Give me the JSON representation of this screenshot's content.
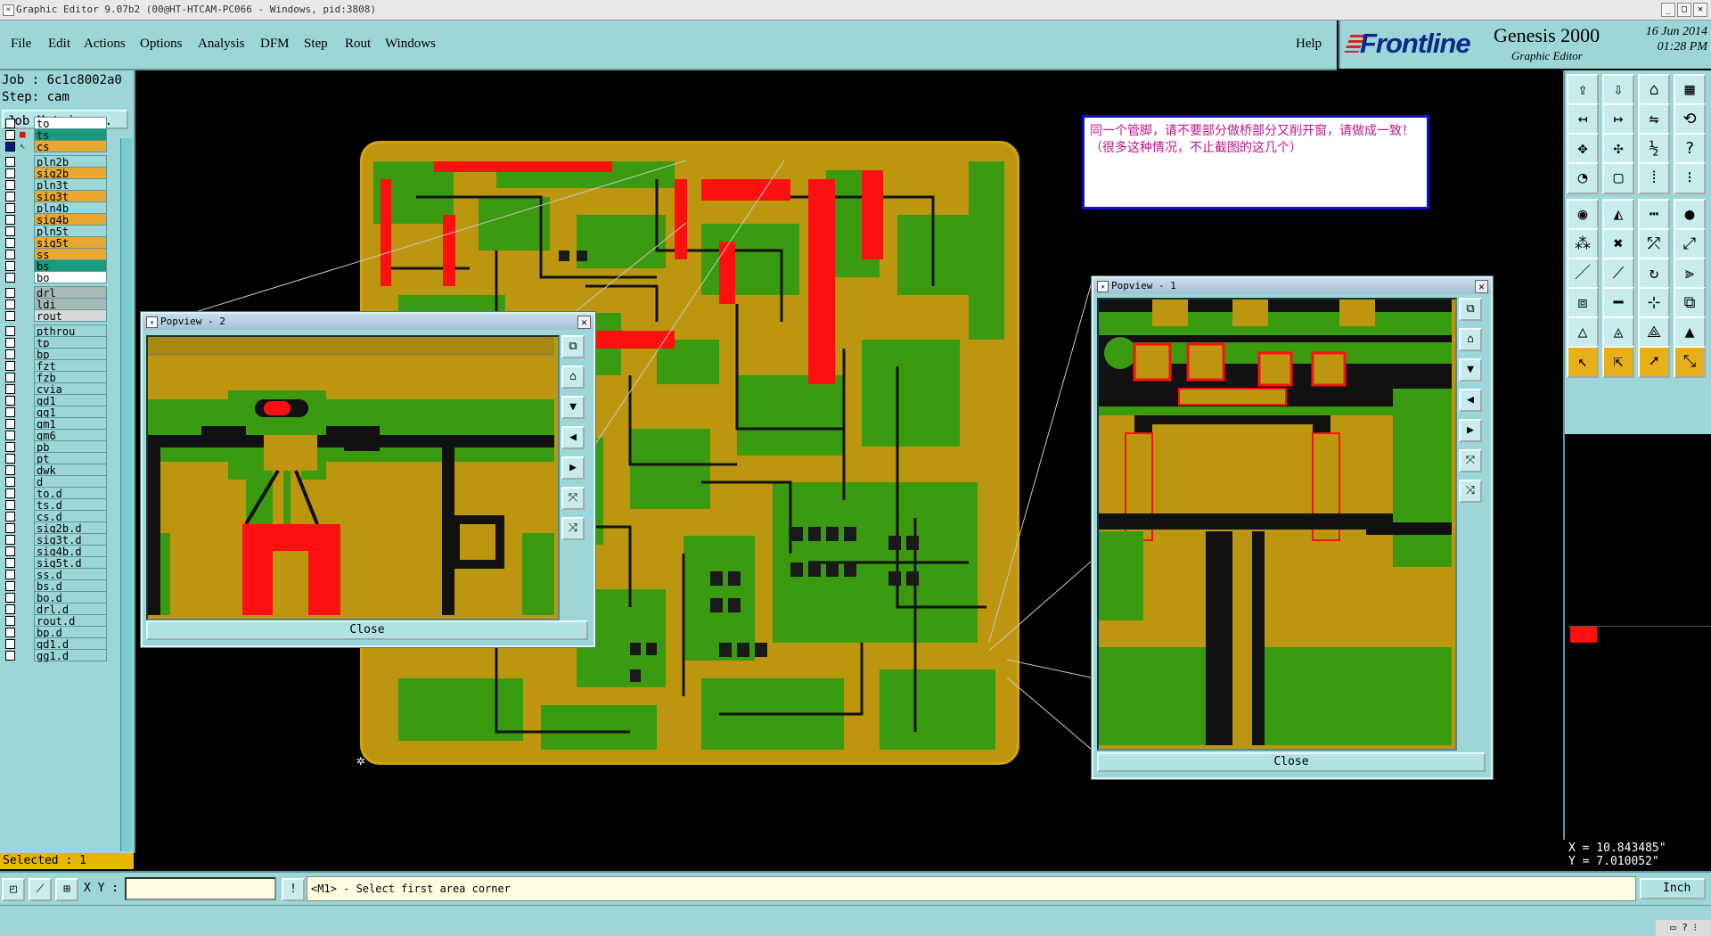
{
  "window": {
    "title": "Graphic Editor 9.07b2 (00@HT-HTCAM-PC066 - Windows, pid:3808)"
  },
  "menu": {
    "items": [
      "File",
      "Edit",
      "Actions",
      "Options",
      "Analysis",
      "DFM",
      "Step",
      "Rout",
      "Windows"
    ],
    "help": "Help"
  },
  "logo": {
    "brand": "Frontline",
    "product": "Genesis 2000",
    "subtitle": "Graphic Editor",
    "date": "16 Jun 2014",
    "time": "01:28 PM"
  },
  "job": {
    "job": "Job  : 6c1c8002a0",
    "step": "Step: cam",
    "matrix_button": "Job Matrix ..."
  },
  "layers": [
    {
      "name": "to",
      "color": "#ffffff"
    },
    {
      "name": "ts",
      "color": "#1a9a7a"
    },
    {
      "name": "cs",
      "color": "#e8a832"
    },
    {
      "name": "pln2b",
      "color": "#9cd6d6"
    },
    {
      "name": "sig2b",
      "color": "#e8a832"
    },
    {
      "name": "pln3t",
      "color": "#9cd6d6"
    },
    {
      "name": "sig3t",
      "color": "#e8a832"
    },
    {
      "name": "pln4b",
      "color": "#9cd6d6"
    },
    {
      "name": "sig4b",
      "color": "#e8a832"
    },
    {
      "name": "pln5t",
      "color": "#9cd6d6"
    },
    {
      "name": "sig5t",
      "color": "#e8a832"
    },
    {
      "name": "ss",
      "color": "#e8a832"
    },
    {
      "name": "bs",
      "color": "#1a9a7a"
    },
    {
      "name": "bo",
      "color": "#ffffff"
    },
    {
      "name": "drl",
      "color": "#a8b8b8"
    },
    {
      "name": "ldi",
      "color": "#a8b8b8"
    },
    {
      "name": "rout",
      "color": "#d8d8d8"
    },
    {
      "name": "pthrou",
      "color": "#9cd6d6"
    },
    {
      "name": "tp",
      "color": "#9cd6d6"
    },
    {
      "name": "bp",
      "color": "#9cd6d6"
    },
    {
      "name": "fzt",
      "color": "#9cd6d6"
    },
    {
      "name": "fzb",
      "color": "#9cd6d6"
    },
    {
      "name": "cvia",
      "color": "#9cd6d6"
    },
    {
      "name": "gd1",
      "color": "#9cd6d6"
    },
    {
      "name": "gg1",
      "color": "#9cd6d6"
    },
    {
      "name": "gm1",
      "color": "#9cd6d6"
    },
    {
      "name": "gm6",
      "color": "#9cd6d6"
    },
    {
      "name": "pb",
      "color": "#9cd6d6"
    },
    {
      "name": "pt",
      "color": "#9cd6d6"
    },
    {
      "name": "dwk",
      "color": "#9cd6d6"
    },
    {
      "name": "d",
      "color": "#9cd6d6"
    },
    {
      "name": "to.d",
      "color": "#9cd6d6"
    },
    {
      "name": "ts.d",
      "color": "#9cd6d6"
    },
    {
      "name": "cs.d",
      "color": "#9cd6d6"
    },
    {
      "name": "sig2b.d",
      "color": "#9cd6d6"
    },
    {
      "name": "sig3t.d",
      "color": "#9cd6d6"
    },
    {
      "name": "sig4b.d",
      "color": "#9cd6d6"
    },
    {
      "name": "sig5t.d",
      "color": "#9cd6d6"
    },
    {
      "name": "ss.d",
      "color": "#9cd6d6"
    },
    {
      "name": "bs.d",
      "color": "#9cd6d6"
    },
    {
      "name": "bo.d",
      "color": "#9cd6d6"
    },
    {
      "name": "drl.d",
      "color": "#9cd6d6"
    },
    {
      "name": "rout.d",
      "color": "#9cd6d6"
    },
    {
      "name": "bp.d",
      "color": "#9cd6d6"
    },
    {
      "name": "gd1.d",
      "color": "#9cd6d6"
    },
    {
      "name": "gg1.d",
      "color": "#9cd6d6"
    }
  ],
  "status": {
    "selected": "Selected : 1",
    "xy_label": "X Y :",
    "xy_value": "",
    "message": "<M1> - Select first area corner",
    "units": "Inch"
  },
  "coords": {
    "x": "X = 10.843485\"",
    "y": "Y = 7.010052\""
  },
  "note": {
    "text": "同一个管脚，请不要部分做桥部分又削开窗，请做成一致！（很多这种情况，不止截图的这几个）"
  },
  "popup1": {
    "title": "Popview - 1",
    "close": "Close"
  },
  "popup2": {
    "title": "Popview - 2",
    "close": "Close"
  },
  "colors": {
    "panel": "#9cd6d6",
    "copper": "#bd9610",
    "mask": "#3a9a10",
    "highlight": "#ff1010"
  }
}
